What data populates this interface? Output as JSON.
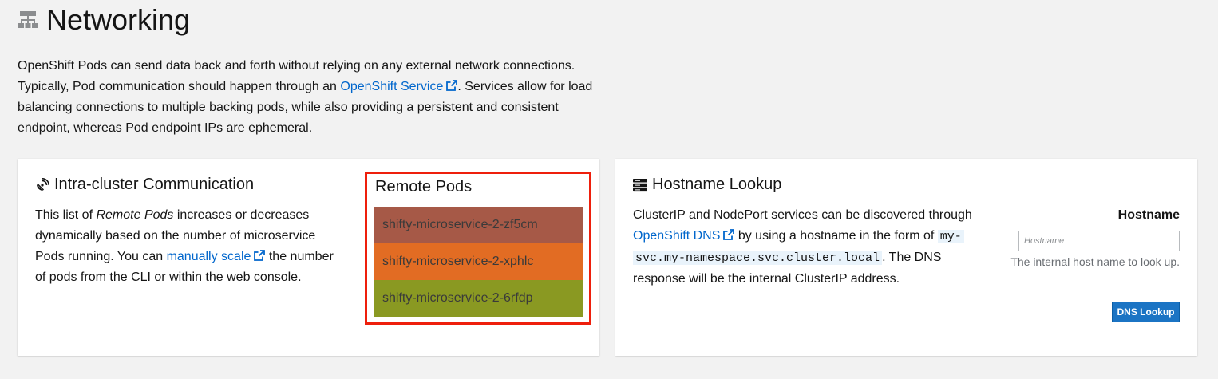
{
  "page": {
    "title": "Networking",
    "title_icon": "network-icon"
  },
  "intro": {
    "text1": "OpenShift Pods can send data back and forth without relying on any external network connections. Typically, Pod communication should happen through an ",
    "link": "OpenShift Service",
    "text2": ". Services allow for load balancing connections to multiple backing pods, while also providing a persistent and consistent endpoint, whereas Pod endpoint IPs are ephemeral."
  },
  "intra": {
    "title": "Intra-cluster Communication",
    "icon": "satellite-icon",
    "text1": "This list of ",
    "emph": "Remote Pods",
    "text2": " increases or decreases dynamically based on the number of microservice Pods running. You can ",
    "link": "manually scale",
    "text3": " the number of pods from the CLI or within the web console."
  },
  "remote_pods": {
    "title": "Remote Pods",
    "pods": [
      {
        "name": "shifty-microservice-2-zf5cm",
        "color": "#a65947"
      },
      {
        "name": "shifty-microservice-2-xphlc",
        "color": "#e26c23"
      },
      {
        "name": "shifty-microservice-2-6rfdp",
        "color": "#8a9922"
      }
    ]
  },
  "hostname_lookup": {
    "title": "Hostname Lookup",
    "icon": "server-icon",
    "text1": "ClusterIP and NodePort services can be discovered through ",
    "link": "OpenShift DNS",
    "text2": " by using a hostname in the form of ",
    "code1": "my-",
    "code2": "svc.my-namespace.svc.cluster.local",
    "text3": ". The DNS response will be the internal ClusterIP address.",
    "field_label": "Hostname",
    "placeholder": "Hostname",
    "value": "",
    "helper": "The internal host name to look up.",
    "button": "DNS Lookup"
  },
  "colors": {
    "link": "#0066cc",
    "highlight_border": "#ee1f0c",
    "button": "#1b74c4"
  }
}
